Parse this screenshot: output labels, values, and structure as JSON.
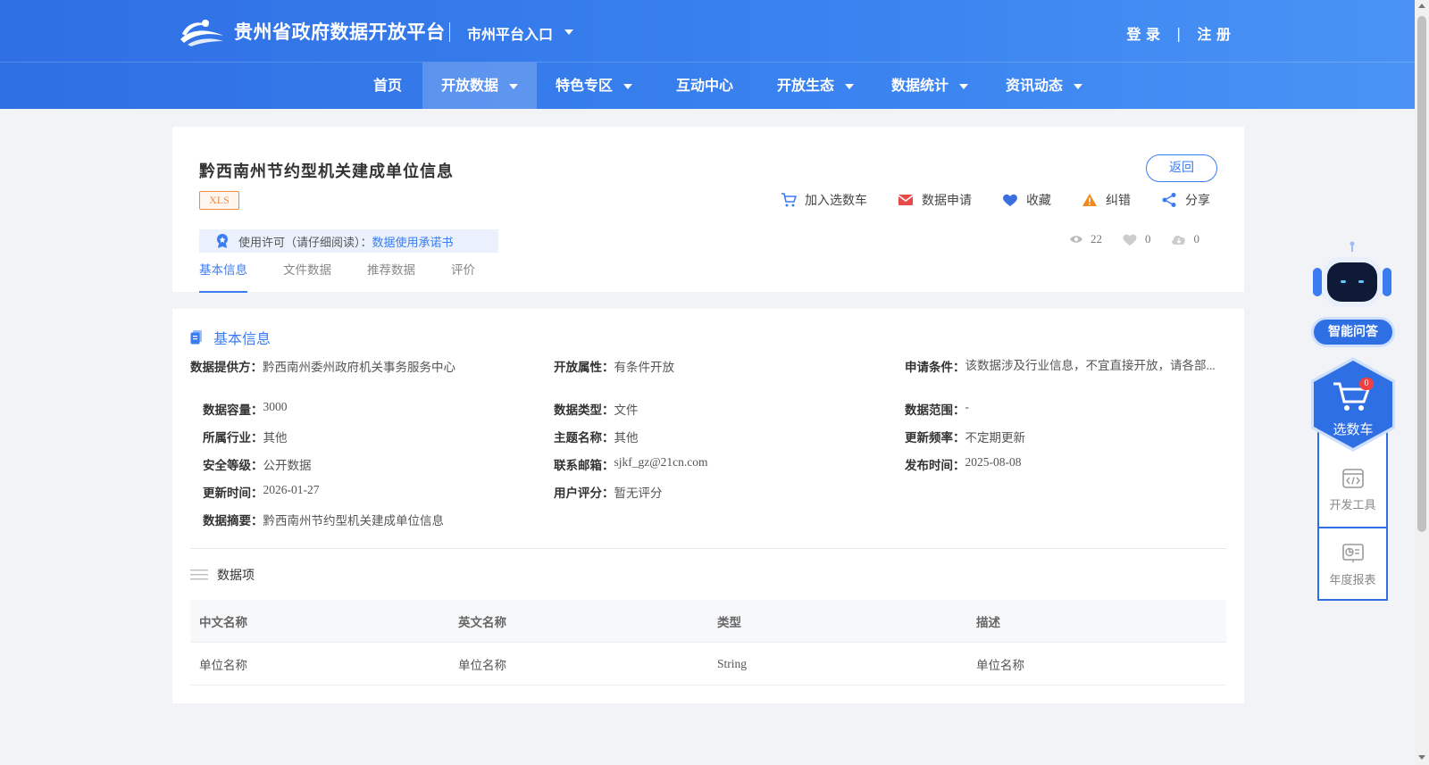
{
  "header": {
    "site_title": "贵州省政府数据开放平台",
    "city_entry": "市州平台入口",
    "login": "登 录",
    "auth_sep": "|",
    "register": "注 册"
  },
  "nav": [
    {
      "label": "首页",
      "dropdown": false,
      "active": false
    },
    {
      "label": "开放数据",
      "dropdown": true,
      "active": true
    },
    {
      "label": "特色专区",
      "dropdown": true,
      "active": false
    },
    {
      "label": "互动中心",
      "dropdown": false,
      "active": false
    },
    {
      "label": "开放生态",
      "dropdown": true,
      "active": false
    },
    {
      "label": "数据统计",
      "dropdown": true,
      "active": false
    },
    {
      "label": "资讯动态",
      "dropdown": true,
      "active": false
    }
  ],
  "dataset": {
    "title": "黔西南州节约型机关建成单位信息",
    "format": "XLS",
    "back": "返回",
    "actions": {
      "cart": "加入选数车",
      "apply": "数据申请",
      "favorite": "收藏",
      "report": "纠错",
      "share": "分享"
    },
    "license_label": "使用许可（请仔细阅读）：",
    "license_link": "数据使用承诺书",
    "stats": {
      "views": "22",
      "likes": "0",
      "downloads": "0"
    },
    "tabs": [
      "基本信息",
      "文件数据",
      "推荐数据",
      "评价"
    ]
  },
  "basic_info": {
    "title": "基本信息",
    "provider_label": "数据提供方：",
    "provider": "黔西南州委州政府机关事务服务中心",
    "open_attr_label": "开放属性：",
    "open_attr": "有条件开放",
    "condition_label": "申请条件：",
    "condition": "该数据涉及行业信息，不宜直接开放，请各部...",
    "capacity_label": "数据容量：",
    "capacity": "3000",
    "type_label": "数据类型：",
    "type": "文件",
    "range_label": "数据范围：",
    "range": "-",
    "industry_label": "所属行业：",
    "industry": "其他",
    "topic_label": "主题名称：",
    "topic": "其他",
    "freq_label": "更新频率：",
    "freq": "不定期更新",
    "security_label": "安全等级：",
    "security": "公开数据",
    "email_label": "联系邮箱：",
    "email": "sjkf_gz@21cn.com",
    "publish_label": "发布时间：",
    "publish": "2025-08-08",
    "update_label": "更新时间：",
    "update": "2026-01-27",
    "rating_label": "用户评分：",
    "rating": "暂无评分",
    "summary_label": "数据摘要：",
    "summary": "黔西南州节约型机关建成单位信息"
  },
  "data_items": {
    "title": "数据项",
    "columns": [
      "中文名称",
      "英文名称",
      "类型",
      "描述"
    ],
    "rows": [
      [
        "单位名称",
        "单位名称",
        "String",
        "单位名称"
      ]
    ]
  },
  "sidebar": {
    "ai": "智能问答",
    "cart": "选数车",
    "cart_count": "0",
    "dev_tools": "开发工具",
    "annual_report": "年度报表"
  },
  "colors": {
    "primary": "#3b7cf0",
    "header": "#2f6fe4",
    "accent_orange": "#f08a3e",
    "danger": "#f04040"
  }
}
